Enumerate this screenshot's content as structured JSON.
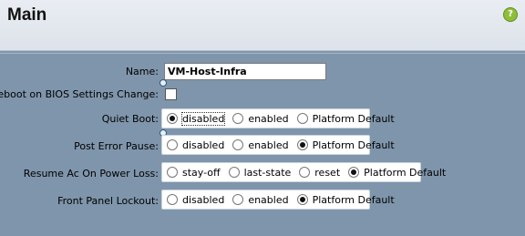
{
  "header": {
    "title": "Main",
    "help_icon": "help-icon"
  },
  "form": {
    "name": {
      "label": "Name:",
      "value": "VM-Host-Infra"
    },
    "reboot": {
      "label": "Reboot on BIOS Settings Change:",
      "checked": false
    },
    "quiet_boot": {
      "label": "Quiet Boot:",
      "options": [
        "disabled",
        "enabled",
        "Platform Default"
      ],
      "selected": "disabled"
    },
    "post_error_pause": {
      "label": "Post Error Pause:",
      "options": [
        "disabled",
        "enabled",
        "Platform Default"
      ],
      "selected": "Platform Default"
    },
    "resume_ac": {
      "label": "Resume Ac On Power Loss:",
      "options": [
        "stay-off",
        "last-state",
        "reset",
        "Platform Default"
      ],
      "selected": "Platform Default"
    },
    "front_panel": {
      "label": "Front Panel Lockout:",
      "options": [
        "disabled",
        "enabled",
        "Platform Default"
      ],
      "selected": "Platform Default"
    }
  },
  "colors": {
    "panel_bg": "#7f95ab",
    "header_bg": "#e9edf3",
    "help_green": "#8fbf3a"
  }
}
